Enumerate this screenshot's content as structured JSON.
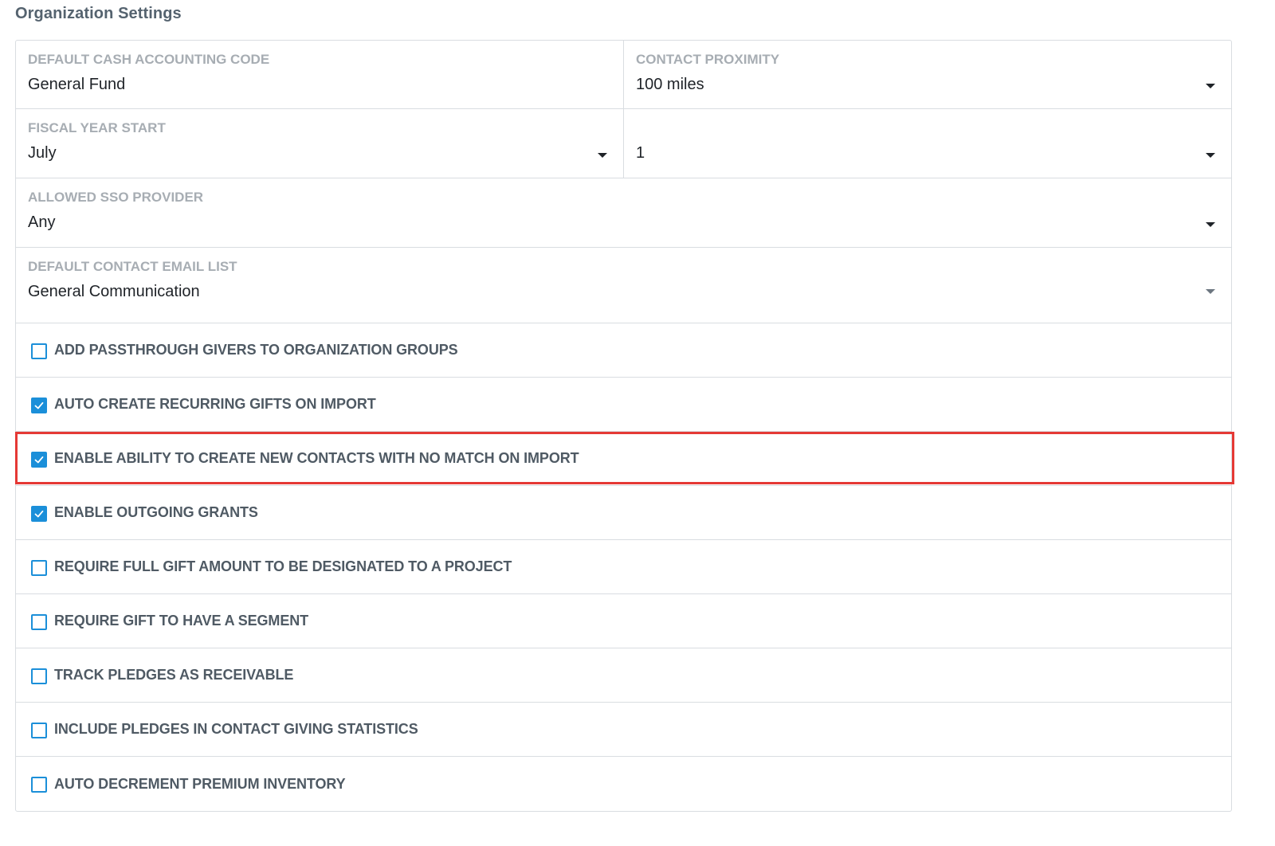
{
  "page": {
    "title": "Organization Settings"
  },
  "fields": {
    "cash_code": {
      "label": "DEFAULT CASH ACCOUNTING CODE",
      "value": "General Fund"
    },
    "proximity": {
      "label": "CONTACT PROXIMITY",
      "value": "100 miles"
    },
    "fiscal_month": {
      "label": "FISCAL YEAR START",
      "value": "July"
    },
    "fiscal_day": {
      "label": "",
      "value": "1"
    },
    "sso": {
      "label": "ALLOWED SSO PROVIDER",
      "value": "Any"
    },
    "email_list": {
      "label": "DEFAULT CONTACT EMAIL LIST",
      "value": "General Communication"
    }
  },
  "checkboxes": [
    {
      "label": "ADD PASSTHROUGH GIVERS TO ORGANIZATION GROUPS",
      "checked": false
    },
    {
      "label": "AUTO CREATE RECURRING GIFTS ON IMPORT",
      "checked": true
    },
    {
      "label": "ENABLE ABILITY TO CREATE NEW CONTACTS WITH NO MATCH ON IMPORT",
      "checked": true
    },
    {
      "label": "ENABLE OUTGOING GRANTS",
      "checked": true
    },
    {
      "label": "REQUIRE FULL GIFT AMOUNT TO BE DESIGNATED TO A PROJECT",
      "checked": false
    },
    {
      "label": "REQUIRE GIFT TO HAVE A SEGMENT",
      "checked": false
    },
    {
      "label": "TRACK PLEDGES AS RECEIVABLE",
      "checked": false
    },
    {
      "label": "INCLUDE PLEDGES IN CONTACT GIVING STATISTICS",
      "checked": false
    },
    {
      "label": "AUTO DECREMENT PREMIUM INVENTORY",
      "checked": false
    }
  ],
  "colors": {
    "accent": "#1b8fd9",
    "highlight": "#e53935",
    "label": "#a7adb3",
    "border": "#d9dde1"
  },
  "icons": {
    "dropdown": "caret-down-icon",
    "checked": "checkmark-icon"
  }
}
